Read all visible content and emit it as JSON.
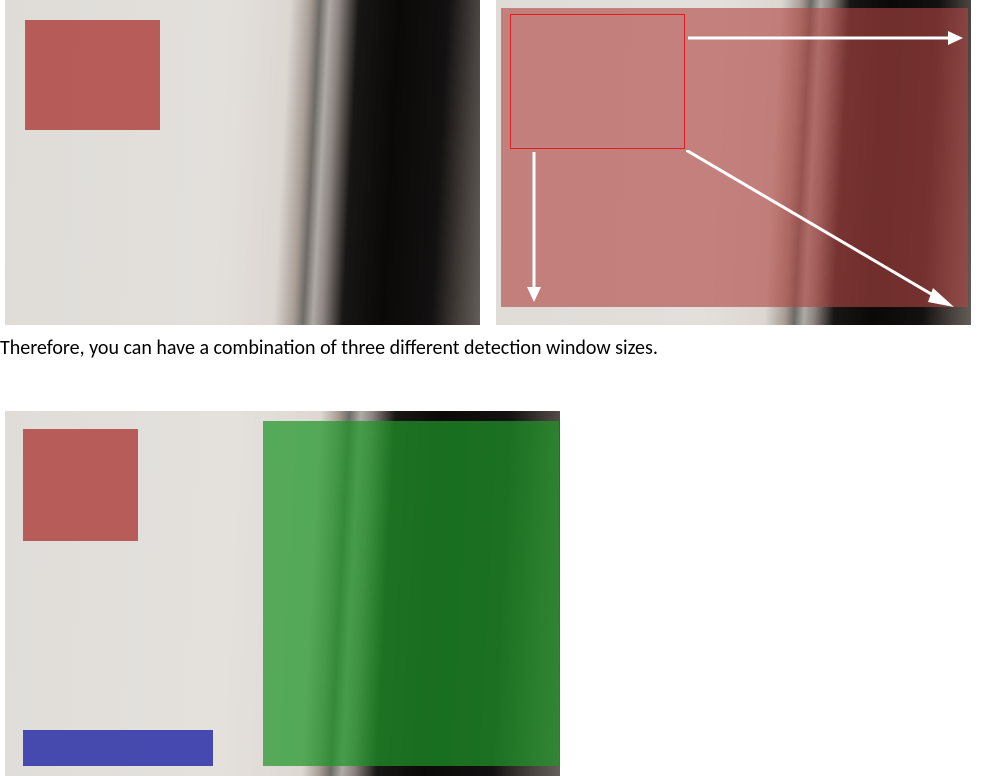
{
  "caption": "Therefore, you can have a combination of three different detection window sizes.",
  "overlays": {
    "top_left": {
      "color": "red-small",
      "desc": "small-detection-window"
    },
    "top_right": {
      "overlay_color": "red-large",
      "outline": "red-outline",
      "arrows": [
        "right",
        "down",
        "diagonal-down-right"
      ]
    },
    "bottom": {
      "red": "small-detection-window",
      "blue": "wide-detection-window",
      "green": "tall-detection-window"
    }
  }
}
